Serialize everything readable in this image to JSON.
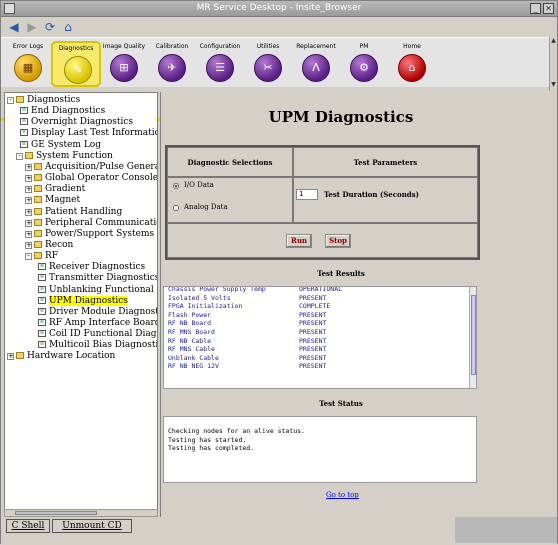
{
  "window": {
    "title": "MR Service Desktop - Insite_Browser"
  },
  "nav": {
    "back": "back-arrow-icon",
    "forward": "forward-arrow-icon",
    "refresh": "refresh-icon",
    "home": "home-icon"
  },
  "tabs": [
    {
      "label": "Error Logs",
      "icon": "error-log-icon"
    },
    {
      "label": "Diagnostics",
      "icon": "diagnostics-icon",
      "active": true
    },
    {
      "label": "Image Quality",
      "icon": "image-quality-icon"
    },
    {
      "label": "Calibration",
      "icon": "calibration-icon"
    },
    {
      "label": "Configuration",
      "icon": "configuration-icon"
    },
    {
      "label": "Utilities",
      "icon": "utilities-icon"
    },
    {
      "label": "Replacement",
      "icon": "replacement-icon"
    },
    {
      "label": "PM",
      "icon": "pm-icon"
    },
    {
      "label": "Home",
      "icon": "home-icon"
    }
  ],
  "tree": [
    {
      "label": "Diagnostics",
      "type": "folder",
      "level": 0,
      "exp": "-"
    },
    {
      "label": "End Diagnostics",
      "type": "doc",
      "level": 1
    },
    {
      "label": "Overnight Diagnostics",
      "type": "doc",
      "level": 1
    },
    {
      "label": "Display Last Test Information",
      "type": "doc",
      "level": 1
    },
    {
      "label": "GE System Log",
      "type": "doc",
      "level": 1
    },
    {
      "label": "System Function",
      "type": "folder",
      "level": 1,
      "exp": "-"
    },
    {
      "label": "Acquisition/Pulse Generation",
      "type": "folder",
      "level": 2,
      "exp": "+"
    },
    {
      "label": "Global Operator Console",
      "type": "folder",
      "level": 2,
      "exp": "+"
    },
    {
      "label": "Gradient",
      "type": "folder",
      "level": 2,
      "exp": "+"
    },
    {
      "label": "Magnet",
      "type": "folder",
      "level": 2,
      "exp": "+"
    },
    {
      "label": "Patient Handling",
      "type": "folder",
      "level": 2,
      "exp": "+"
    },
    {
      "label": "Peripheral Communications",
      "type": "folder",
      "level": 2,
      "exp": "+"
    },
    {
      "label": "Power/Support Systems",
      "type": "folder",
      "level": 2,
      "exp": "+"
    },
    {
      "label": "Recon",
      "type": "folder",
      "level": 2,
      "exp": "+"
    },
    {
      "label": "RF",
      "type": "folder",
      "level": 2,
      "exp": "-"
    },
    {
      "label": "Receiver Diagnostics",
      "type": "doc",
      "level": 3
    },
    {
      "label": "Transmitter Diagnostics",
      "type": "doc",
      "level": 3
    },
    {
      "label": "Unblanking Functional Diagnostics",
      "type": "doc",
      "level": 3
    },
    {
      "label": "UPM Diagnostics",
      "type": "doc",
      "level": 3,
      "selected": true
    },
    {
      "label": "Driver Module Diagnostics",
      "type": "doc",
      "level": 3
    },
    {
      "label": "RF Amp Interface Board Logic",
      "type": "doc",
      "level": 3
    },
    {
      "label": "Coil ID Functional Diagnostics",
      "type": "doc",
      "level": 3
    },
    {
      "label": "Multicoil Bias Diagnostics",
      "type": "doc",
      "level": 3
    },
    {
      "label": "Hardware Location",
      "type": "folder",
      "level": 0,
      "exp": "+"
    }
  ],
  "bottom": {
    "shell": "C Shell",
    "unmount": "Unmount CD"
  },
  "main": {
    "title": "UPM Diagnostics",
    "diag_sel_header": "Diagnostic Selections",
    "test_params_header": "Test Parameters",
    "io_data": "I/O Data",
    "analog_data": "Analog Data",
    "duration_value": "1",
    "duration_label": "Test Duration (Seconds)",
    "run": "Run",
    "stop": "Stop",
    "results_header": "Test Results",
    "results": [
      {
        "name": "Chassis Power Supply Temp",
        "value": "OPERATIONAL"
      },
      {
        "name": "Isolated 5 Volts",
        "value": "PRESENT"
      },
      {
        "name": "FPGA Initialization",
        "value": " COMPLETE"
      },
      {
        "name": "Flash Power",
        "value": "PRESENT"
      },
      {
        "name": "RF NB Board",
        "value": "PRESENT"
      },
      {
        "name": "RF MNS Board",
        "value": "PRESENT"
      },
      {
        "name": "RF NB Cable",
        "value": "PRESENT"
      },
      {
        "name": "RF MNS Cable",
        "value": "PRESENT"
      },
      {
        "name": "Unblank Cable",
        "value": "PRESENT"
      },
      {
        "name": "RF NB NEG 12V",
        "value": "PRESENT"
      }
    ],
    "status_header": "Test Status",
    "status_lines": [
      "Checking nodes for an alive status.",
      "Testing has started.",
      "Testing has completed."
    ],
    "go_to_top": "Go to top"
  }
}
